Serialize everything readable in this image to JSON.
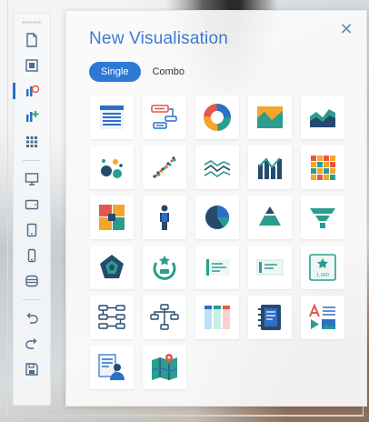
{
  "panel": {
    "title": "New Visualisation",
    "close_label": "✕",
    "tabs": [
      {
        "label": "Single",
        "active": true
      },
      {
        "label": "Combo",
        "active": false
      }
    ]
  },
  "toolbar": {
    "items": [
      {
        "icon": "page-icon"
      },
      {
        "icon": "layout-icon"
      },
      {
        "icon": "add-visualisation-icon",
        "active": true
      },
      {
        "icon": "add-chart-icon"
      },
      {
        "icon": "grid-icon"
      },
      {
        "icon": "desktop-icon"
      },
      {
        "icon": "tablet-landscape-icon"
      },
      {
        "icon": "tablet-portrait-icon"
      },
      {
        "icon": "phone-icon"
      },
      {
        "icon": "database-icon"
      },
      {
        "icon": "undo-icon"
      },
      {
        "icon": "redo-icon"
      },
      {
        "icon": "save-icon"
      }
    ]
  },
  "visualisations": [
    {
      "icon": "table-icon"
    },
    {
      "icon": "pivot-table-icon"
    },
    {
      "icon": "donut-chart-icon"
    },
    {
      "icon": "area-chart-icon"
    },
    {
      "icon": "stacked-area-chart-icon"
    },
    {
      "icon": "bubble-chart-icon"
    },
    {
      "icon": "scatter-chart-icon"
    },
    {
      "icon": "line-chart-icon"
    },
    {
      "icon": "column-line-chart-icon"
    },
    {
      "icon": "heatmap-icon"
    },
    {
      "icon": "treemap-icon"
    },
    {
      "icon": "person-chart-icon"
    },
    {
      "icon": "pie-chart-icon"
    },
    {
      "icon": "pyramid-chart-icon"
    },
    {
      "icon": "funnel-chart-icon"
    },
    {
      "icon": "radar-chart-icon"
    },
    {
      "icon": "gauge-icon"
    },
    {
      "icon": "kpi-card-icon"
    },
    {
      "icon": "kpi-card-2-icon"
    },
    {
      "icon": "kpi-target-icon"
    },
    {
      "icon": "flow-chart-icon"
    },
    {
      "icon": "tree-chart-icon"
    },
    {
      "icon": "kanban-icon"
    },
    {
      "icon": "notebook-icon"
    },
    {
      "icon": "text-image-icon"
    },
    {
      "icon": "profile-icon"
    },
    {
      "icon": "map-icon"
    }
  ],
  "colors": {
    "accent": "#2d7ad6",
    "title": "#3b7bd0",
    "teal": "#2a9d8f",
    "navy": "#264a6e",
    "orange": "#f4a52a",
    "red": "#e4574c"
  },
  "kpi_value": "1,000"
}
